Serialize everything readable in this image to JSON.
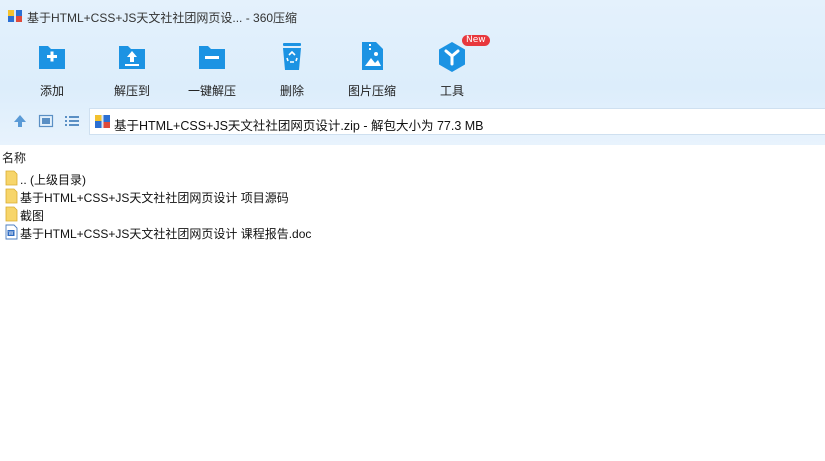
{
  "window": {
    "title": "基于HTML+CSS+JS天文社社团网页设... - 360压缩"
  },
  "toolbar": {
    "add_label": "添加",
    "extract_to_label": "解压到",
    "one_click_extract_label": "一键解压",
    "delete_label": "删除",
    "image_compress_label": "图片压缩",
    "tools_label": "工具",
    "tools_badge": "New"
  },
  "navbar": {
    "path": "基于HTML+CSS+JS天文社社团网页设计.zip - 解包大小为 77.3 MB"
  },
  "list": {
    "column_name": "名称",
    "rows": [
      {
        "name": ".. (上级目录)",
        "icon": "folder-icon"
      },
      {
        "name": "基于HTML+CSS+JS天文社社团网页设计 项目源码",
        "icon": "folder-icon"
      },
      {
        "name": "截图",
        "icon": "folder-icon"
      },
      {
        "name": "基于HTML+CSS+JS天文社社团网页设计 课程报告.doc",
        "icon": "word-doc-icon"
      }
    ]
  },
  "colors": {
    "accent_blue": "#1c93e3",
    "badge_red": "#e8383d",
    "folder_yellow": "#f7d56a"
  }
}
